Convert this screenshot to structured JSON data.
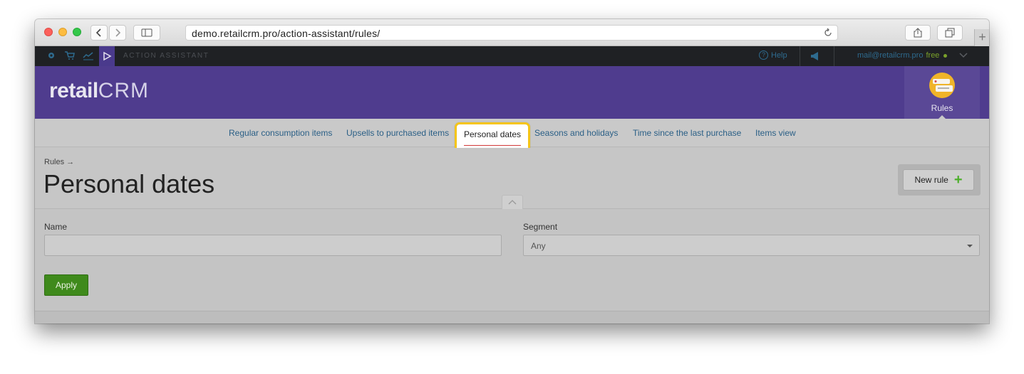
{
  "browser": {
    "url": "demo.retailcrm.pro/action-assistant/rules/",
    "new_tab_symbol": "+"
  },
  "topbar": {
    "module_name": "ACTION ASSISTANT",
    "help_label": "Help",
    "account_email": "mail@retailcrm.pro",
    "account_plan": "free"
  },
  "header": {
    "logo_text": "retail",
    "logo_text_2": "CRM",
    "rules_tile_label": "Rules"
  },
  "tabs": [
    {
      "label": "Regular consumption items"
    },
    {
      "label": "Upsells to purchased items"
    },
    {
      "label": "Personal dates"
    },
    {
      "label": "Seasons and holidays"
    },
    {
      "label": "Time since the last purchase"
    },
    {
      "label": "Items view"
    }
  ],
  "page": {
    "breadcrumb": "Rules →",
    "title": "Personal dates",
    "new_rule_label": "New rule"
  },
  "filters": {
    "name_label": "Name",
    "name_value": "",
    "segment_label": "Segment",
    "segment_value": "Any",
    "apply_label": "Apply"
  },
  "colors": {
    "accent_purple": "#4f3c8e",
    "highlight_yellow": "#f5c518",
    "apply_green": "#3f8a1c"
  }
}
